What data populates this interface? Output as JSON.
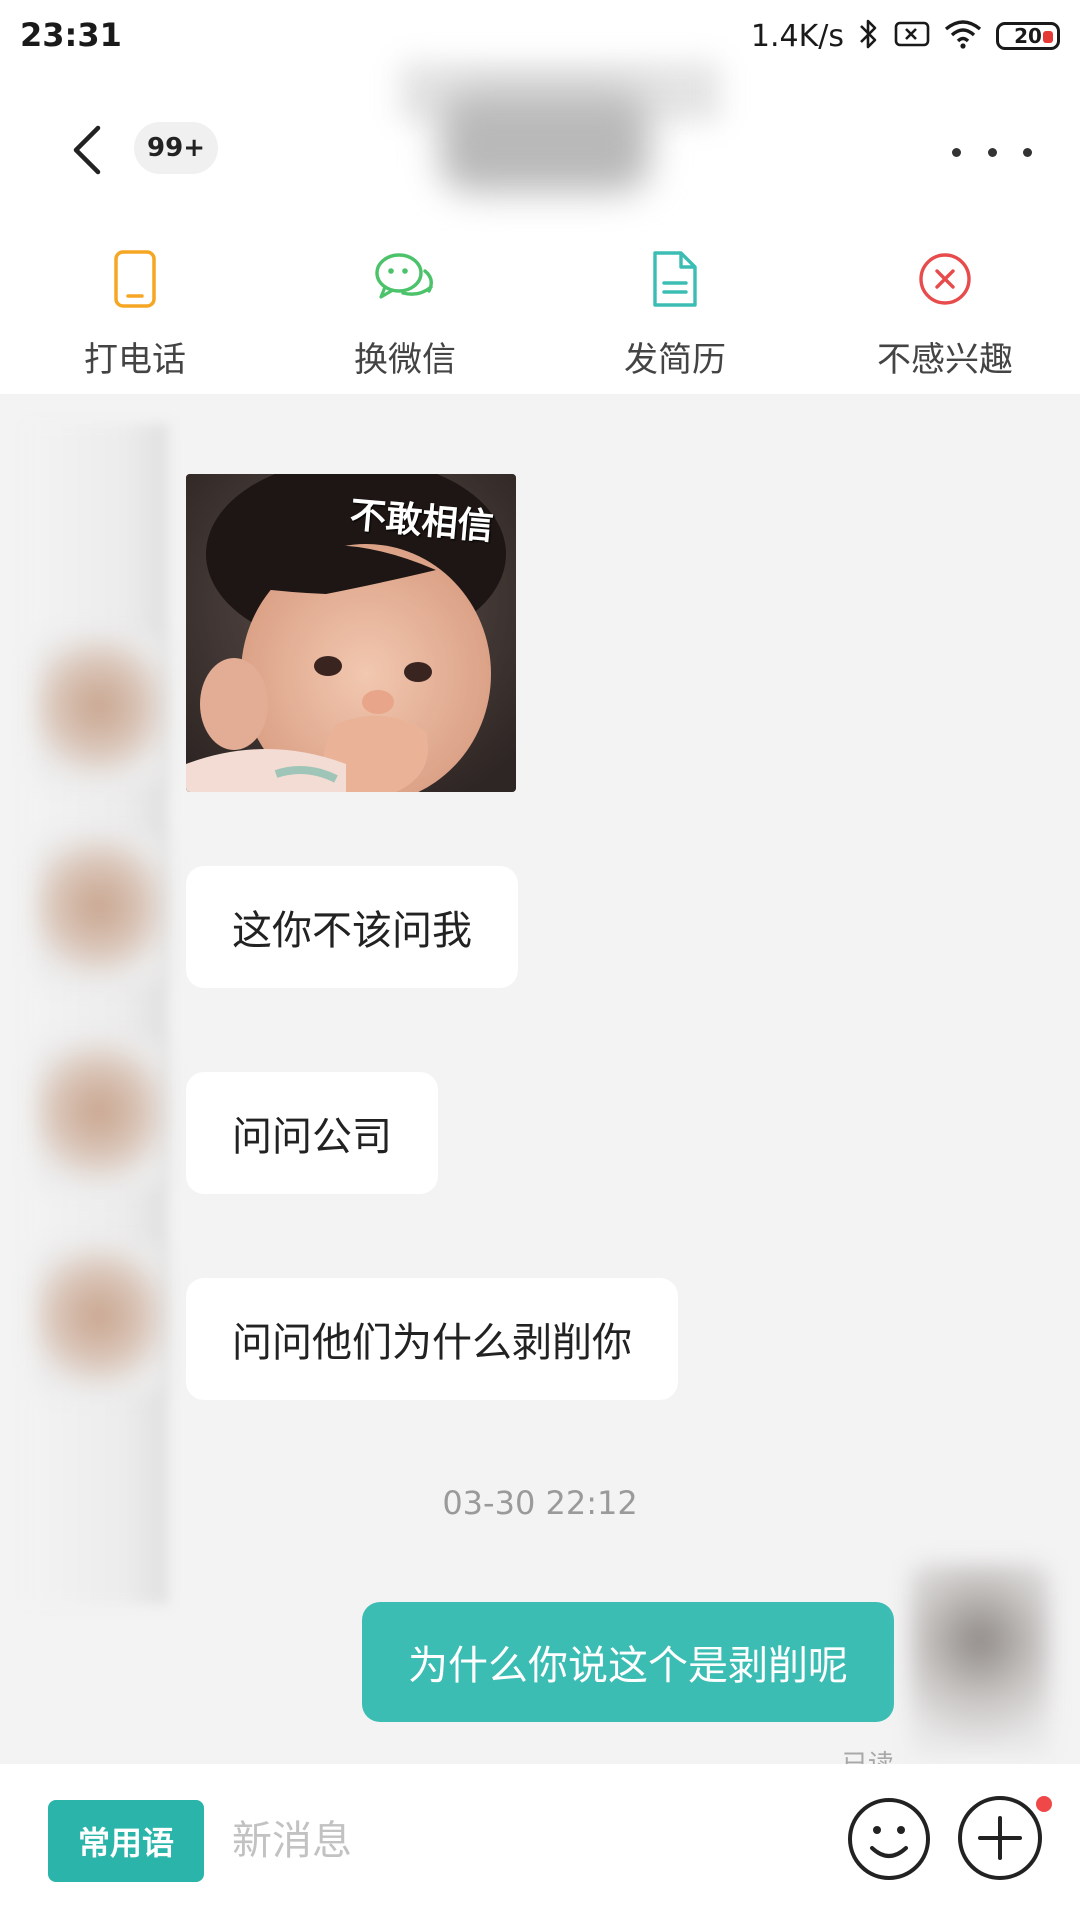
{
  "status_bar": {
    "time": "23:31",
    "net_speed": "1.4K/s",
    "battery_level": "20"
  },
  "header": {
    "unread_badge": "99+",
    "back_icon": "chevron-left-icon",
    "more_icon": "more-horizontal-icon"
  },
  "actions": [
    {
      "label": "打电话",
      "icon": "phone-icon",
      "color": "#f5a623"
    },
    {
      "label": "换微信",
      "icon": "wechat-icon",
      "color": "#4cc36a"
    },
    {
      "label": "发简历",
      "icon": "resume-icon",
      "color": "#3bbdb4"
    },
    {
      "label": "不感兴趣",
      "icon": "close-circle-icon",
      "color": "#e84b4b"
    }
  ],
  "messages": {
    "sticker_caption": "不敢相信",
    "received": [
      "这你不该问我",
      "问问公司",
      "问问他们为什么剥削你"
    ],
    "timestamp": "03-30 22:12",
    "sent": "为什么你说这个是剥削呢",
    "read_receipt": "已读"
  },
  "input_bar": {
    "phrases_label": "常用语",
    "placeholder": "新消息",
    "value": ""
  },
  "colors": {
    "accent": "#2bb5aa",
    "sent_bubble": "#3bbdb4",
    "notification_dot": "#f04848"
  }
}
